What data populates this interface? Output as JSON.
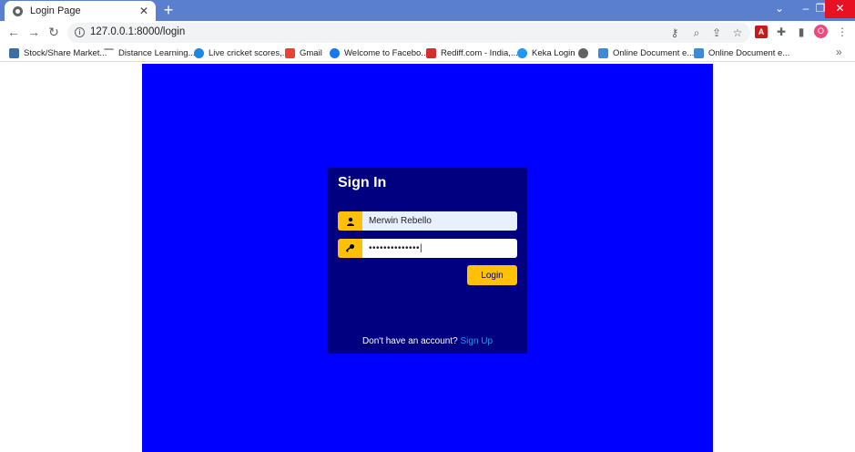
{
  "browser": {
    "tab_title": "Login Page",
    "tab_close": "✕",
    "new_tab": "+",
    "url": "127.0.0.1:8000/login",
    "window_controls": {
      "chevron": "⌄",
      "minimize": "–",
      "maximize": "❐",
      "close": "✕"
    },
    "bookmarks": [
      {
        "label": "Stock/Share Market...",
        "icon": "stock-icon",
        "color": "#3a6ea5"
      },
      {
        "label": "Distance Learning...",
        "icon": "dash-icon",
        "color": "#9aa0a6"
      },
      {
        "label": "Live cricket scores,...",
        "icon": "cricket-icon",
        "color": "#1e88e5"
      },
      {
        "label": "Gmail",
        "icon": "gmail-icon",
        "color": "#ea4335"
      },
      {
        "label": "Welcome to Facebo...",
        "icon": "facebook-icon",
        "color": "#1877f2"
      },
      {
        "label": "Rediff.com - India,...",
        "icon": "rediff-icon",
        "color": "#d32f2f"
      },
      {
        "label": "Keka Login",
        "icon": "keka-icon",
        "color": "#2196f3"
      },
      {
        "label": "",
        "icon": "globe-icon",
        "color": "#5f6368"
      },
      {
        "label": "Online Document e...",
        "icon": "doc-icon",
        "color": "#3d8bd8"
      },
      {
        "label": "Online Document e...",
        "icon": "doc-icon",
        "color": "#3d8bd8"
      }
    ],
    "bookmarks_more": "»",
    "profile_initial": "O"
  },
  "login": {
    "title": "Sign In",
    "username_value": "Merwin Rebello",
    "password_value": "••••••••••••••|",
    "button_label": "Login",
    "signup_prompt": "Don't have an account?",
    "signup_link": "Sign Up"
  },
  "colors": {
    "stage": "#0000ff",
    "card": "#000080",
    "accent": "#ffc107",
    "link": "#2196f3"
  }
}
